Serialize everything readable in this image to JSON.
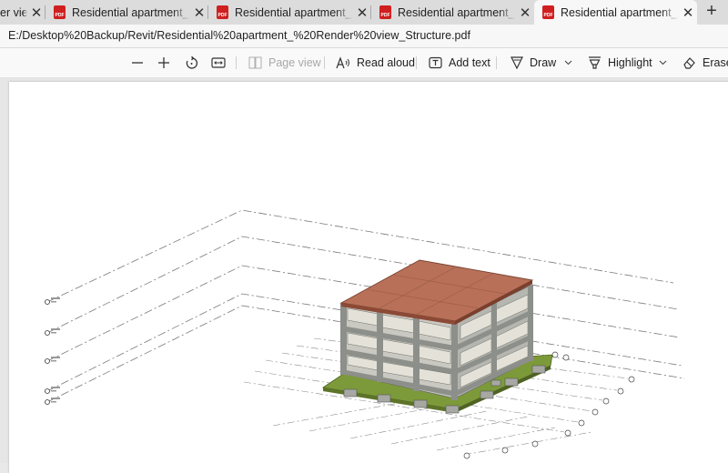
{
  "tabs": [
    {
      "title": "Residential apartment_ Render view_Structure.pdf",
      "active": false
    },
    {
      "title": "Residential apartment_ Render view_Structure.pdf",
      "active": false
    },
    {
      "title": "Residential apartment_ Render view_Structure.pdf",
      "active": false
    },
    {
      "title": "Residential apartment_ Render view_Structure.pdf",
      "active": false
    },
    {
      "title": "Residential apartment_ Render view_Structure.pdf",
      "active": true
    }
  ],
  "first_tab_fragment": "er view",
  "pdf_badge": "PDF",
  "new_tab_symbol": "+",
  "close_symbol": "✕",
  "address": "E:/Desktop%20Backup/Revit/Residential%20apartment_%20Render%20view_Structure.pdf",
  "toolbar": {
    "page_view": "Page view",
    "read_aloud": "Read aloud",
    "add_text": "Add text",
    "draw": "Draw",
    "highlight": "Highlight",
    "erase": "Erase"
  },
  "colors": {
    "roof": "#b87058",
    "slab": "#7d9a3a",
    "frame": "#8d8f8a"
  }
}
